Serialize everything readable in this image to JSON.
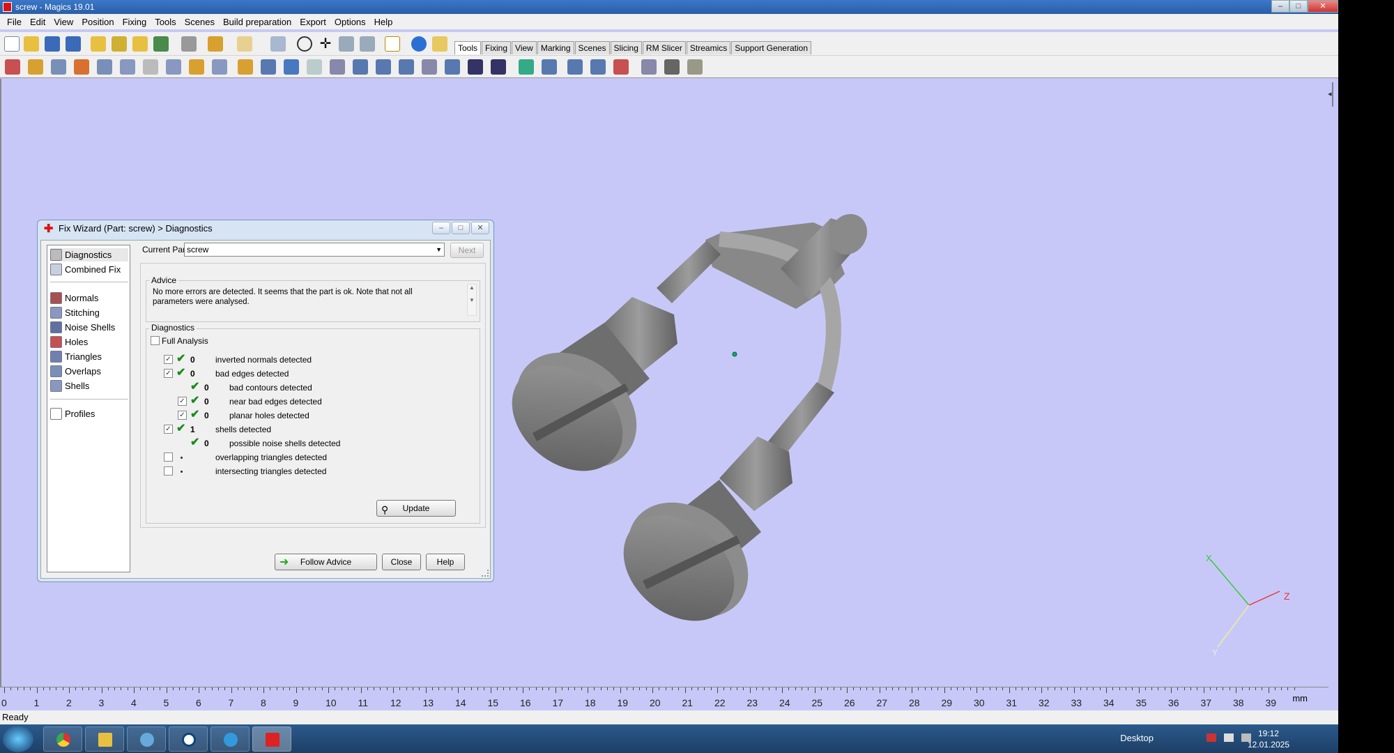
{
  "window": {
    "title": "screw - Magics 19.01",
    "min": "–",
    "max": "□",
    "close": "✕"
  },
  "menu": [
    "File",
    "Edit",
    "View",
    "Position",
    "Fixing",
    "Tools",
    "Scenes",
    "Build preparation",
    "Export",
    "Options",
    "Help"
  ],
  "tabs": [
    "Tools",
    "Fixing",
    "View",
    "Marking",
    "Scenes",
    "Slicing",
    "RM Slicer",
    "Streamics",
    "Support Generation"
  ],
  "active_tab": "Tools",
  "colors": {
    "viewport": "#c8c8f8",
    "check": "#1a8a1a",
    "axis_x": "#3c3",
    "axis_z": "#e33"
  },
  "dialog": {
    "title": "Fix Wizard (Part: screw) > Diagnostics",
    "nav_top": [
      {
        "label": "Diagnostics",
        "icon": "magnifier-icon"
      },
      {
        "label": "Combined Fix",
        "icon": "cube-icon"
      }
    ],
    "nav_mid": [
      {
        "label": "Normals",
        "icon": "normals-icon"
      },
      {
        "label": "Stitching",
        "icon": "stitching-icon"
      },
      {
        "label": "Noise Shells",
        "icon": "noise-shells-icon"
      },
      {
        "label": "Holes",
        "icon": "holes-icon"
      },
      {
        "label": "Triangles",
        "icon": "triangles-icon"
      },
      {
        "label": "Overlaps",
        "icon": "overlaps-icon"
      },
      {
        "label": "Shells",
        "icon": "shells-icon"
      }
    ],
    "nav_bottom": [
      {
        "label": "Profiles",
        "icon": "profiles-icon"
      }
    ],
    "current_part_label": "Current Part:",
    "current_part_value": "screw",
    "next_button": "Next",
    "advice_title": "Advice",
    "advice_text": "No more errors are detected. It seems that the part is ok. Note that not all parameters were analysed.",
    "diagnostics_title": "Diagnostics",
    "full_analysis_label": "Full Analysis",
    "rows": [
      {
        "checkbox": true,
        "checked": true,
        "status": "ok",
        "count": "0",
        "text": "inverted normals detected",
        "indent": 0
      },
      {
        "checkbox": true,
        "checked": true,
        "status": "ok",
        "count": "0",
        "text": "bad edges detected",
        "indent": 0
      },
      {
        "checkbox": false,
        "checked": false,
        "status": "ok",
        "count": "0",
        "text": "bad contours detected",
        "indent": 1
      },
      {
        "checkbox": true,
        "checked": true,
        "status": "ok",
        "count": "0",
        "text": "near bad edges detected",
        "indent": 1
      },
      {
        "checkbox": true,
        "checked": true,
        "status": "ok",
        "count": "0",
        "text": "planar holes detected",
        "indent": 1
      },
      {
        "checkbox": true,
        "checked": true,
        "status": "ok",
        "count": "1",
        "text": "shells detected",
        "indent": 0
      },
      {
        "checkbox": false,
        "checked": false,
        "status": "ok",
        "count": "0",
        "text": "possible noise shells detected",
        "indent": 1
      },
      {
        "checkbox": true,
        "checked": false,
        "status": "dot",
        "count": "",
        "text": "overlapping triangles detected",
        "indent": 0
      },
      {
        "checkbox": true,
        "checked": false,
        "status": "dot",
        "count": "",
        "text": "intersecting triangles detected",
        "indent": 0
      }
    ],
    "update_button": "Update",
    "follow_advice_button": "Follow Advice",
    "close_button": "Close",
    "help_button": "Help"
  },
  "ruler": {
    "labels": [
      "0",
      "1",
      "2",
      "3",
      "4",
      "5",
      "6",
      "7",
      "8",
      "9",
      "10",
      "11",
      "12",
      "13",
      "14",
      "15",
      "16",
      "17",
      "18",
      "19",
      "20",
      "21",
      "22",
      "23",
      "24",
      "25",
      "26",
      "27",
      "28",
      "29",
      "30",
      "31",
      "32",
      "33",
      "34",
      "35",
      "36",
      "37",
      "38",
      "39"
    ],
    "unit": "mm"
  },
  "axes": {
    "x": "X",
    "y": "Y",
    "z": "Z"
  },
  "status": "Ready",
  "taskbar": {
    "desktop_label": "Desktop",
    "time": "19:12",
    "date": "12.01.2025"
  }
}
